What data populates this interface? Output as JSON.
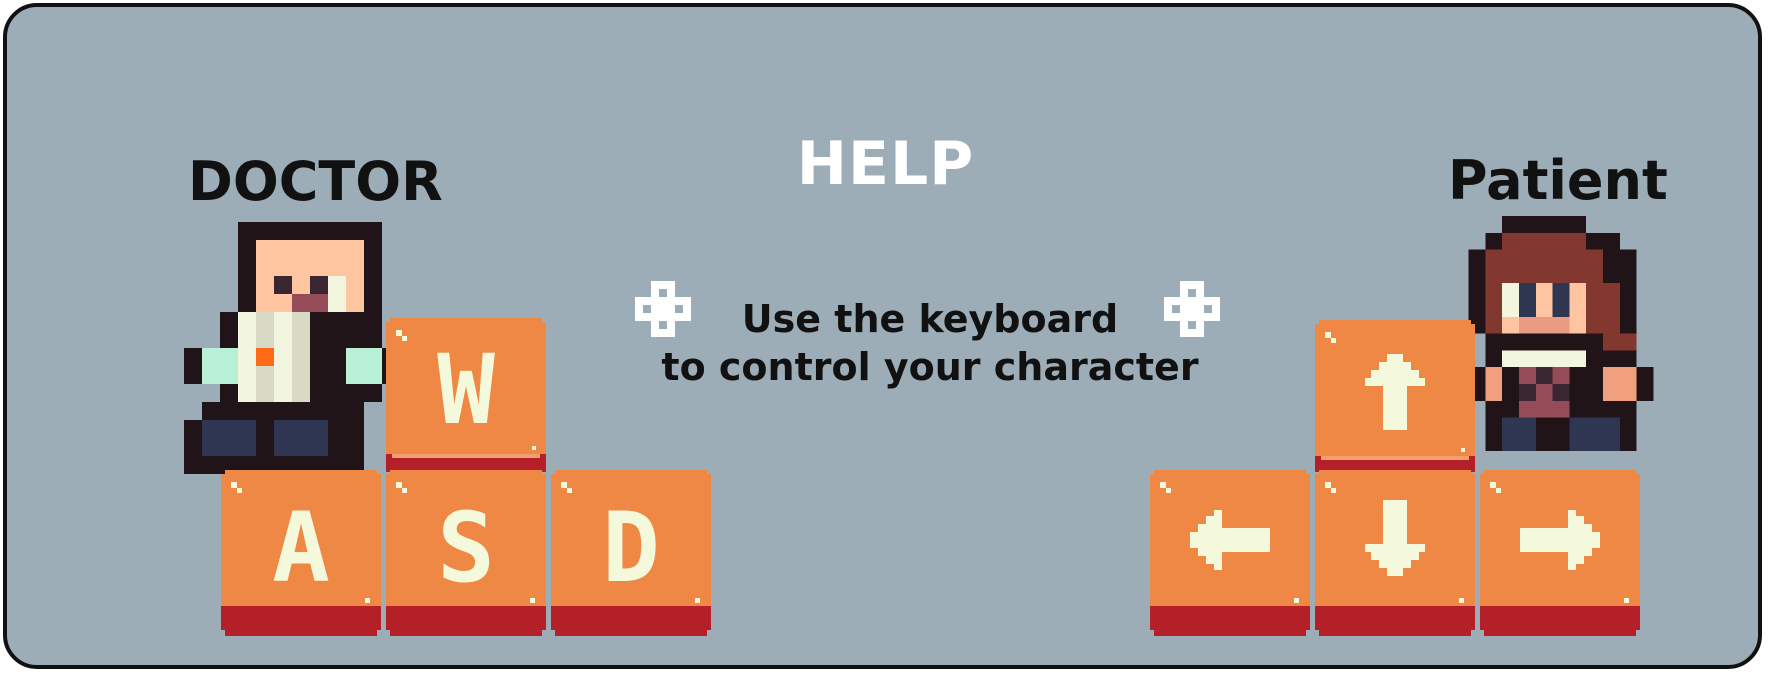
{
  "screen": {
    "title": "HELP",
    "instruction_line1": "Use the keyboard",
    "instruction_line2": "to control your character"
  },
  "players": {
    "left": {
      "label": "DOCTOR",
      "keys": [
        "W",
        "A",
        "S",
        "D"
      ]
    },
    "right": {
      "label": "Patient",
      "keys": [
        "up-arrow",
        "left-arrow",
        "down-arrow",
        "right-arrow"
      ]
    }
  },
  "icons": [
    "sparkle-icon",
    "doctor-sprite",
    "patient-sprite",
    "up-arrow-icon",
    "down-arrow-icon",
    "left-arrow-icon",
    "right-arrow-icon"
  ],
  "colors": {
    "background": "#9dadb8",
    "border": "#111111",
    "key_face": "#ef8844",
    "key_base": "#b51f27",
    "key_glyph": "#f4f9dc",
    "title": "#ffffff",
    "text": "#111111"
  }
}
